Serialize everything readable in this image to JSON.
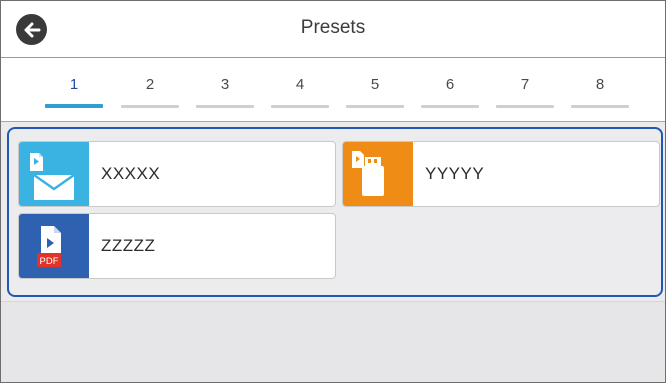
{
  "header": {
    "title": "Presets",
    "back_icon": "back-arrow-icon"
  },
  "tabs": [
    {
      "label": "1",
      "active": true
    },
    {
      "label": "2",
      "active": false
    },
    {
      "label": "3",
      "active": false
    },
    {
      "label": "4",
      "active": false
    },
    {
      "label": "5",
      "active": false
    },
    {
      "label": "6",
      "active": false
    },
    {
      "label": "7",
      "active": false
    },
    {
      "label": "8",
      "active": false
    }
  ],
  "presets": [
    {
      "label": "XXXXX",
      "icon": "scan-to-email-icon",
      "color": "#3bb3e2"
    },
    {
      "label": "YYYYY",
      "icon": "scan-to-memory-device-icon",
      "color": "#ef8c16"
    },
    {
      "label": "ZZZZZ",
      "icon": "scan-to-pdf-icon",
      "color": "#2e62b0"
    }
  ],
  "colors": {
    "accent": "#2457b3",
    "active_tab_bar": "#2f9ed0",
    "pdf_badge": "#e0332a"
  }
}
